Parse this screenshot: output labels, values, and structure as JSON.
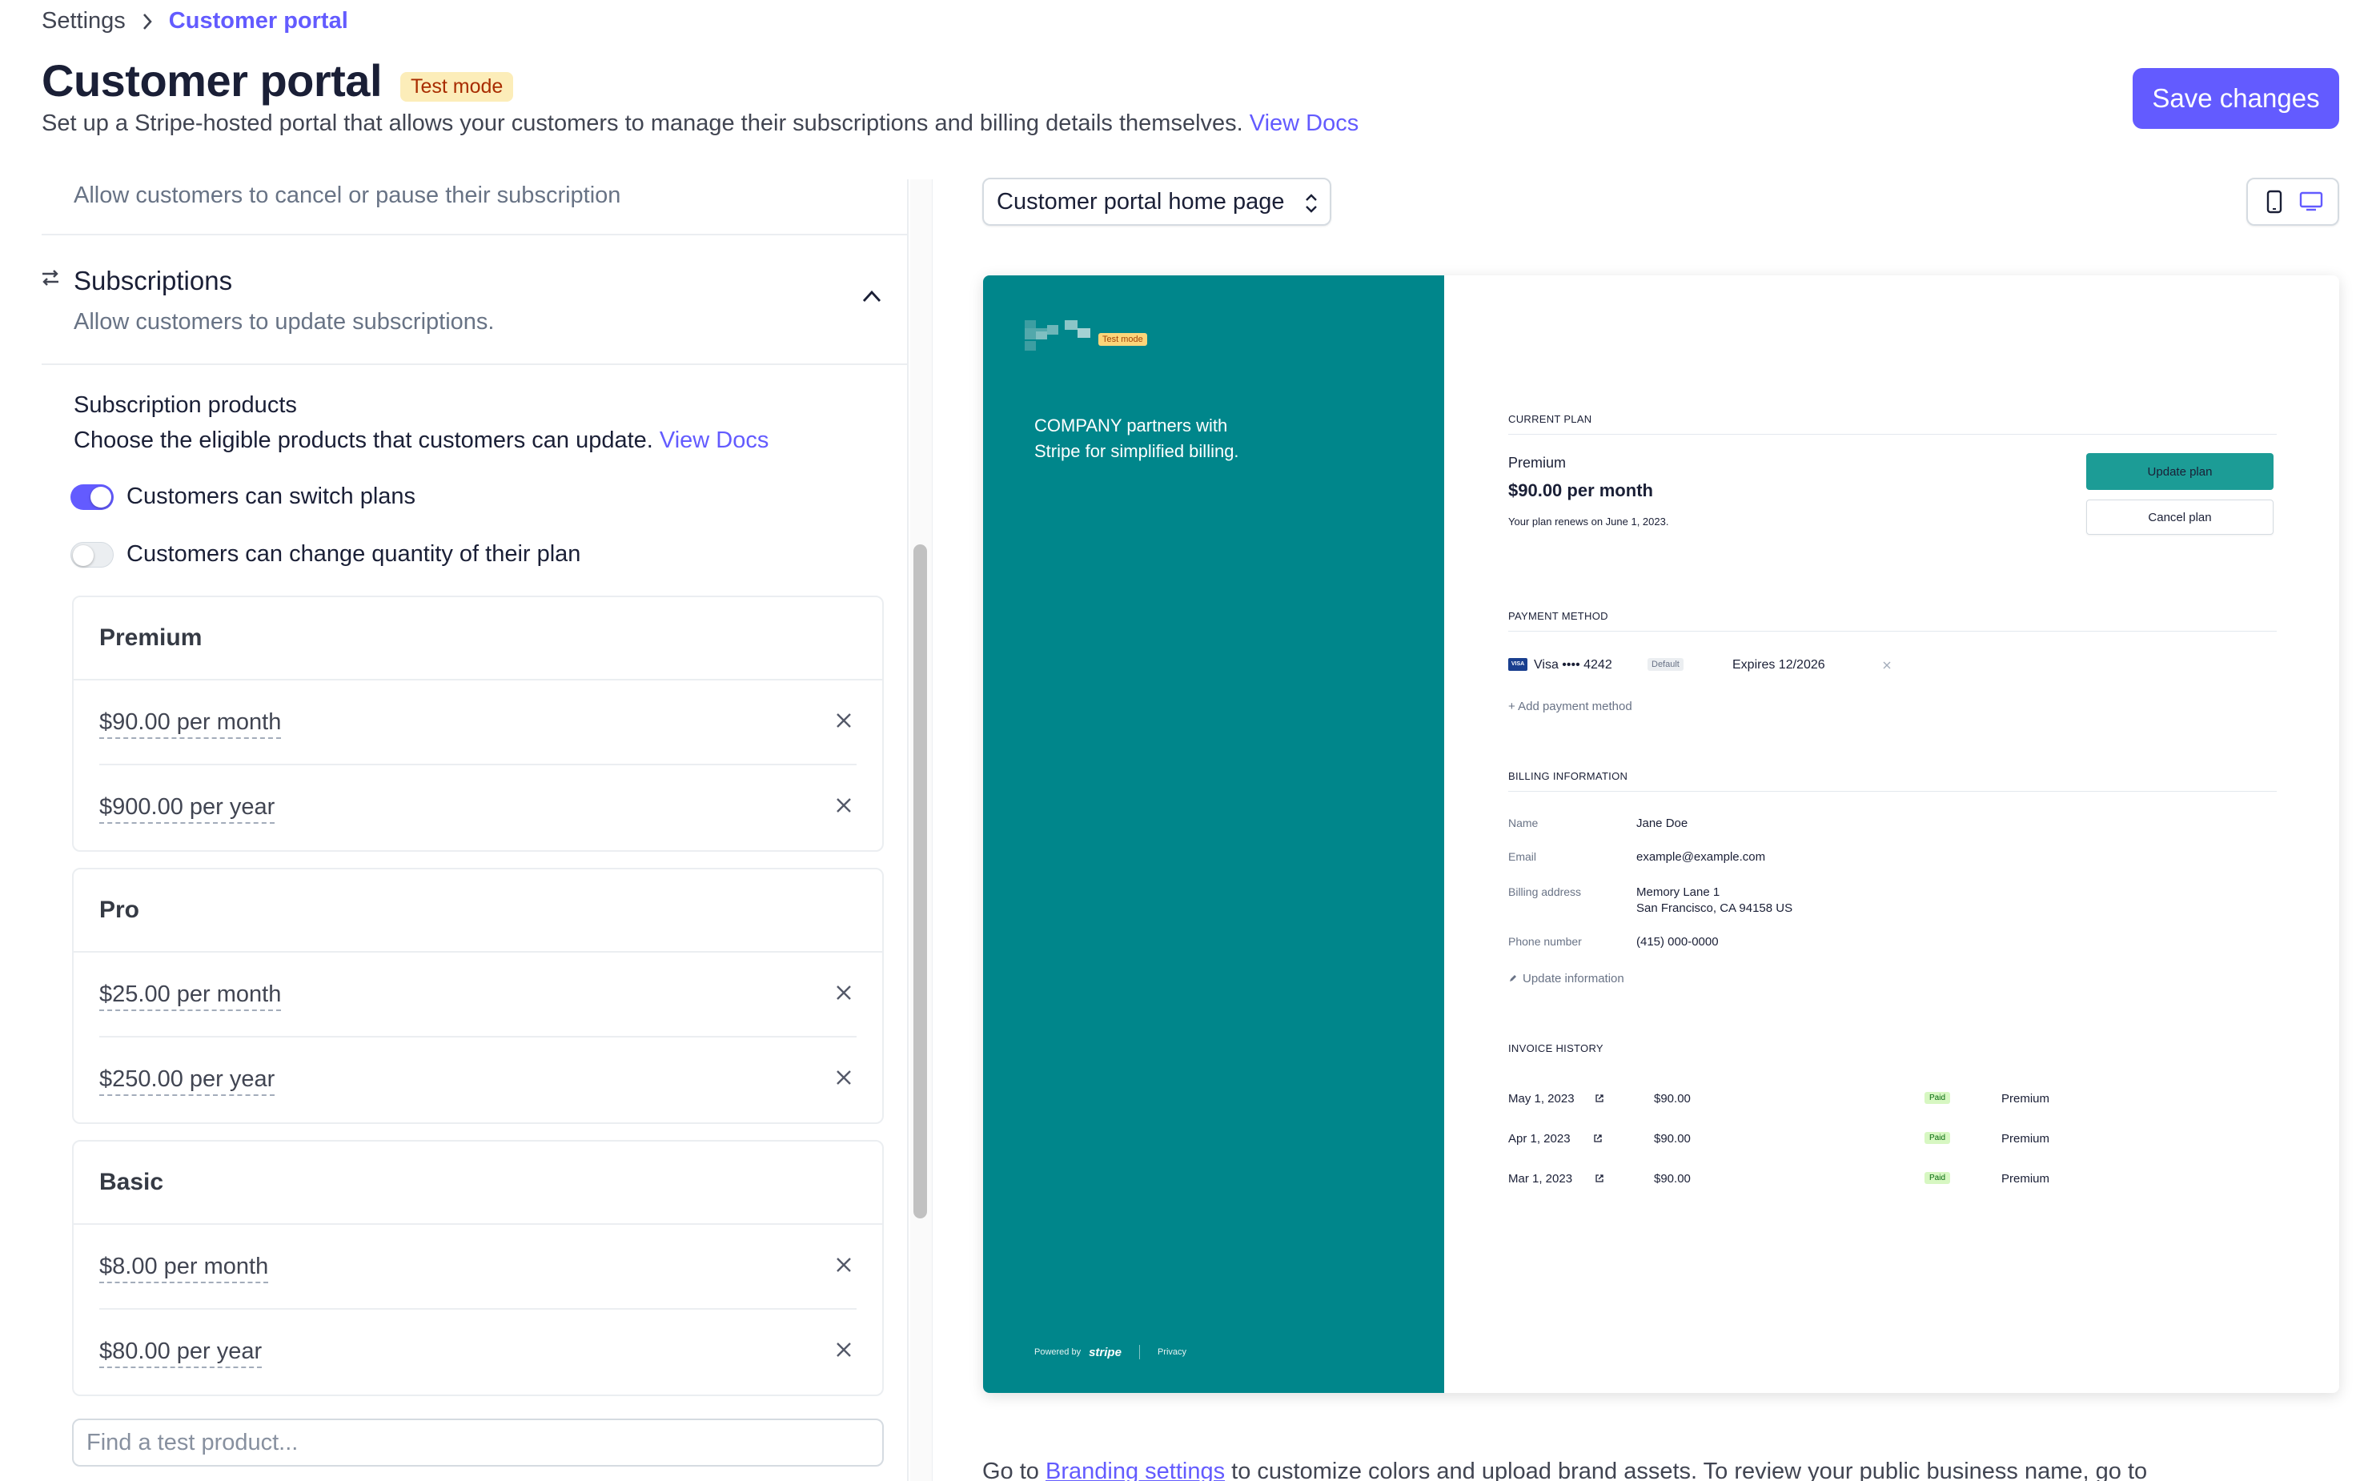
{
  "breadcrumb": {
    "parent": "Settings",
    "current": "Customer portal"
  },
  "header": {
    "title": "Customer portal",
    "badge": "Test mode",
    "subtitle": "Set up a Stripe-hosted portal that allows your customers to manage their subscriptions and billing details themselves.",
    "docs_link": "View Docs",
    "save_label": "Save changes"
  },
  "left": {
    "cancellation_desc": "Allow customers to cancel or pause their subscription",
    "subscriptions": {
      "title": "Subscriptions",
      "desc": "Allow customers to update subscriptions.",
      "icon": "arrows-swap-icon"
    },
    "products": {
      "title": "Subscription products",
      "desc": "Choose the eligible products that customers can update.",
      "docs_link": "View Docs"
    },
    "toggles": [
      {
        "label": "Customers can switch plans",
        "on": true
      },
      {
        "label": "Customers can change quantity of their plan",
        "on": false
      }
    ],
    "product_cards": [
      {
        "name": "Premium",
        "prices": [
          "$90.00 per month",
          "$900.00 per year"
        ]
      },
      {
        "name": "Pro",
        "prices": [
          "$25.00 per month",
          "$250.00 per year"
        ]
      },
      {
        "name": "Basic",
        "prices": [
          "$8.00 per month",
          "$80.00 per year"
        ]
      }
    ],
    "search_placeholder": "Find a test product..."
  },
  "right": {
    "page_select": "Customer portal home page",
    "device_icons": [
      "mobile-icon",
      "desktop-icon"
    ],
    "preview": {
      "badge": "Test mode",
      "tagline": "COMPANY partners with Stripe for simplified billing.",
      "footer": {
        "powered_by": "Powered by",
        "brand": "stripe",
        "privacy": "Privacy"
      },
      "current_plan": {
        "label": "CURRENT PLAN",
        "plan": "Premium",
        "price": "$90.00 per month",
        "renews": "Your plan renews on June 1, 2023.",
        "update_btn": "Update plan",
        "cancel_btn": "Cancel plan"
      },
      "payment_method": {
        "label": "PAYMENT METHOD",
        "card_brand": "VISA",
        "card": "Visa •••• 4242",
        "default_badge": "Default",
        "expires": "Expires 12/2026",
        "add": "+ Add payment method"
      },
      "billing": {
        "label": "BILLING INFORMATION",
        "rows": [
          {
            "key": "Name",
            "value": "Jane Doe"
          },
          {
            "key": "Email",
            "value": "example@example.com"
          },
          {
            "key": "Billing address",
            "value": "Memory Lane 1",
            "value2": "San Francisco, CA 94158 US"
          },
          {
            "key": "Phone number",
            "value": "(415) 000-0000"
          }
        ],
        "update": "Update information"
      },
      "invoices": {
        "label": "INVOICE HISTORY",
        "rows": [
          {
            "date": "May 1, 2023",
            "amount": "$90.00",
            "status": "Paid",
            "plan": "Premium"
          },
          {
            "date": "Apr 1, 2023",
            "amount": "$90.00",
            "status": "Paid",
            "plan": "Premium"
          },
          {
            "date": "Mar 1, 2023",
            "amount": "$90.00",
            "status": "Paid",
            "plan": "Premium"
          }
        ]
      }
    },
    "bottom": {
      "prefix": "Go to",
      "link": "Branding settings",
      "suffix": "to customize colors and upload brand assets. To review your public business name, go to"
    }
  },
  "colors": {
    "accent": "#635bff",
    "portal_brand": "#00868b",
    "portal_button": "#1c9c96"
  }
}
